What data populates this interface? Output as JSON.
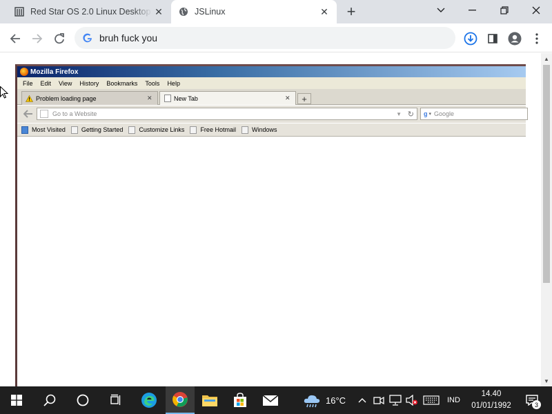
{
  "browser": {
    "tabs": [
      {
        "title": "Red Star OS 2.0 Linux Desktop :",
        "favicon": "document-icon",
        "active": false
      },
      {
        "title": "JSLinux",
        "favicon": "globe-icon",
        "active": true
      }
    ],
    "address": {
      "value": "bruh fuck you"
    }
  },
  "emulator": {
    "window_title": "Mozilla Firefox",
    "menu": [
      "File",
      "Edit",
      "View",
      "History",
      "Bookmarks",
      "Tools",
      "Help"
    ],
    "tabs": [
      {
        "title": "Problem loading page",
        "icon": "warning-icon"
      },
      {
        "title": "New Tab",
        "icon": "blank-page-icon"
      }
    ],
    "url_placeholder": "Go to a Website",
    "search_placeholder": "Google",
    "bookmarks": [
      "Most Visited",
      "Getting Started",
      "Customize Links",
      "Free Hotmail",
      "Windows"
    ]
  },
  "taskbar": {
    "temperature": "16°C",
    "language": "IND",
    "time": "14.40",
    "date": "01/01/1992",
    "notification_count": "3"
  }
}
